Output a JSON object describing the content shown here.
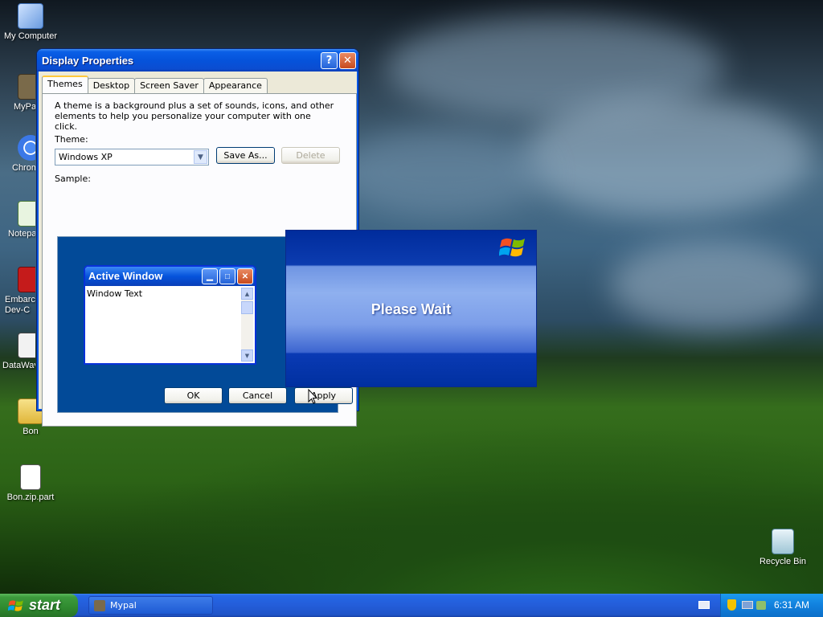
{
  "desktop": {
    "icons": [
      {
        "label": "My Computer"
      },
      {
        "label": "MyPal"
      },
      {
        "label": "Chrome"
      },
      {
        "label": "Notepad"
      },
      {
        "label": "Embarcadero Dev-C"
      },
      {
        "label": "DataWave"
      },
      {
        "label": "Bon"
      },
      {
        "label": "Bon.zip.part"
      },
      {
        "label": "Recycle Bin"
      }
    ]
  },
  "dialog": {
    "title": "Display Properties",
    "tabs": [
      "Themes",
      "Desktop",
      "Screen Saver",
      "Appearance"
    ],
    "description": "A theme is a background plus a set of sounds, icons, and other elements to help you personalize your computer with one click.",
    "theme_label": "Theme:",
    "theme_value": "Windows XP",
    "save_as": "Save As...",
    "delete": "Delete",
    "sample_label": "Sample:",
    "sample": {
      "window_title": "Active Window",
      "window_text": "Window Text"
    },
    "ok": "OK",
    "cancel": "Cancel",
    "apply": "Apply"
  },
  "wait_dialog": {
    "message": "Please Wait"
  },
  "taskbar": {
    "start": "start",
    "item": "Mypal",
    "clock": "6:31 AM"
  }
}
